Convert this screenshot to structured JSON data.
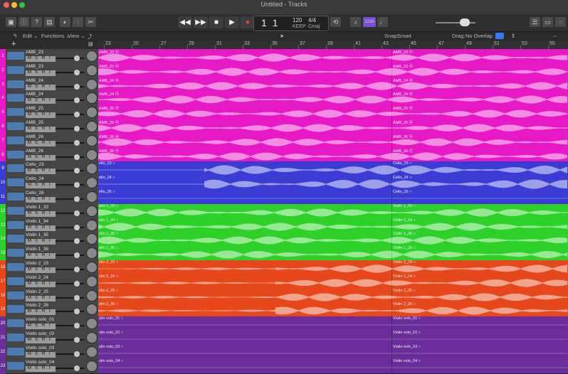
{
  "window": {
    "title": "Untitled - Tracks"
  },
  "toolbar": {
    "lcd": {
      "position": "1 1",
      "tempo": "120",
      "tempo_label": "KEEP",
      "signature": "4/4",
      "key": "Cmaj"
    },
    "count_in": "1234"
  },
  "menubar": {
    "edit": "Edit ⌄",
    "functions": "Functions ⌄",
    "view": "View ⌄",
    "snap_label": "Snap:",
    "snap_value": "Smart",
    "drag_label": "Drag:",
    "drag_value": "No Overlap"
  },
  "ruler": {
    "bars": [
      "23",
      "25",
      "27",
      "29",
      "31",
      "33",
      "35",
      "37",
      "39",
      "41",
      "43",
      "45",
      "47",
      "49",
      "51",
      "53",
      "55"
    ]
  },
  "colors": {
    "magenta": "#e619c4",
    "blue": "#3b3cd4",
    "green": "#2ed12a",
    "orange": "#e6471b",
    "purple": "#6b2d9a"
  },
  "tracks": [
    {
      "num": "1",
      "name": "AMB_23",
      "color": "#e619c4"
    },
    {
      "num": "2",
      "name": "AMB_23",
      "color": "#e619c4"
    },
    {
      "num": "3",
      "name": "AMB_24",
      "color": "#e619c4"
    },
    {
      "num": "4",
      "name": "AMB_24",
      "color": "#e619c4"
    },
    {
      "num": "5",
      "name": "AMB_25",
      "color": "#e619c4"
    },
    {
      "num": "6",
      "name": "AMB_25",
      "color": "#e619c4"
    },
    {
      "num": "7",
      "name": "AMB_26",
      "color": "#e619c4"
    },
    {
      "num": "8",
      "name": "AMB_26",
      "color": "#e619c4"
    },
    {
      "num": "9",
      "name": "Cello_23",
      "color": "#3b3cd4"
    },
    {
      "num": "10",
      "name": "Cello_24",
      "color": "#3b3cd4"
    },
    {
      "num": "11",
      "name": "Cello_26",
      "color": "#3b3cd4"
    },
    {
      "num": "12",
      "name": "Violin 1_33",
      "color": "#2ed12a"
    },
    {
      "num": "13",
      "name": "Violin 1_34",
      "color": "#2ed12a"
    },
    {
      "num": "14",
      "name": "Violin 1_35",
      "color": "#2ed12a"
    },
    {
      "num": "15",
      "name": "Violin 1_36",
      "color": "#2ed12a"
    },
    {
      "num": "16",
      "name": "Violin 2_23",
      "color": "#e6471b"
    },
    {
      "num": "17",
      "name": "Violin 2_24",
      "color": "#e6471b"
    },
    {
      "num": "18",
      "name": "Violin 2_25",
      "color": "#e6471b"
    },
    {
      "num": "19",
      "name": "Violin 2_26",
      "color": "#e6471b"
    },
    {
      "num": "20",
      "name": "Violin solo_01",
      "color": "#6b2d9a"
    },
    {
      "num": "21",
      "name": "Violin solo_02",
      "color": "#6b2d9a"
    },
    {
      "num": "22",
      "name": "Violin solo_03",
      "color": "#6b2d9a"
    },
    {
      "num": "23",
      "name": "Violin solo_04",
      "color": "#6b2d9a"
    }
  ],
  "regions": [
    [
      "AMB_23 ⦿",
      "AMB_23 ⦿"
    ],
    [
      "AMB_23 ⦿",
      "AMB_23 ⦿"
    ],
    [
      "AMB_24 ⦿",
      "AMB_24 ⦿"
    ],
    [
      "AMB_24 ⦿",
      "AMB_24 ⦿"
    ],
    [
      "AMB_25 ⦿",
      "AMB_25 ⦿"
    ],
    [
      "AMB_25 ⦿",
      "AMB_25 ⦿"
    ],
    [
      "AMB_26 ⦿",
      "AMB_26 ⦿"
    ],
    [
      "AMB_26 ⦿",
      "AMB_26 ⦿"
    ],
    [
      "ello_23 ○",
      "Cello_23 ○"
    ],
    [
      "ello_24 ○",
      "Cello_24 ○"
    ],
    [
      "ello_26 ○",
      "Cello_26 ○"
    ],
    [
      "olin 1_33 ○",
      "Violin 1_33 ○"
    ],
    [
      "olin 1_34 ○",
      "Violin 1_34 ○"
    ],
    [
      "olin 1_35 ○",
      "Violin 1_35 ○"
    ],
    [
      "olin 1_36 ○",
      "Violin 1_36 ○"
    ],
    [
      "olin 2_23 ○",
      "Violin 2_23 ○"
    ],
    [
      "olin 2_24 ○",
      "Violin 2_24 ○"
    ],
    [
      "olin 2_25 ○",
      "Violin 2_25 ○"
    ],
    [
      "olin 2_26 ○",
      "Violin 2_26 ○"
    ],
    [
      "olin solo_01 ○",
      "Violin solo_01 ○"
    ],
    [
      "olin solo_02 ○",
      "Violin solo_02 ○"
    ],
    [
      "olin solo_03 ○",
      "Violin solo_03 ○"
    ],
    [
      "olin solo_04 ○",
      "Violin solo_04 ○"
    ]
  ],
  "msri": [
    "M",
    "S",
    "R",
    "I"
  ]
}
